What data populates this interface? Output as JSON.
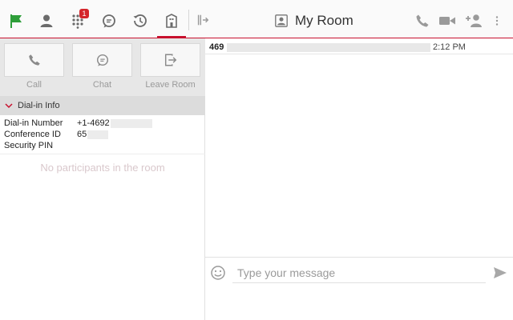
{
  "nav": {
    "badge_count": "1"
  },
  "header": {
    "title": "My Room"
  },
  "actions": {
    "call": "Call",
    "chat": "Chat",
    "leave": "Leave Room"
  },
  "dial_in": {
    "section_title": "Dial-in Info",
    "rows": [
      {
        "label": "Dial-in Number",
        "value": "+1-4692"
      },
      {
        "label": "Conference ID",
        "value": "65"
      },
      {
        "label": "Security PIN",
        "value": ""
      }
    ]
  },
  "participants": {
    "empty_text": "No participants in the room"
  },
  "chat": {
    "messages": [
      {
        "from": "469",
        "time": "2:12 PM"
      }
    ],
    "input_placeholder": "Type your message"
  },
  "colors": {
    "accent": "#c8102e",
    "flag": "#2e9e3a",
    "badge": "#d4262c"
  }
}
